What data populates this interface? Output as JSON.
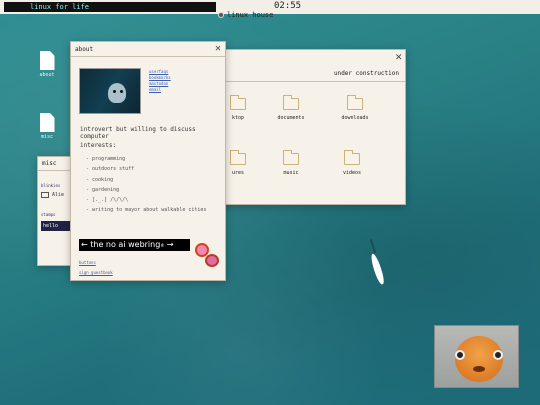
{
  "topbar": {
    "banner_text": "linux for life",
    "clock": "02:55",
    "location_label": "linux house"
  },
  "desktop_icons": [
    {
      "label": "about"
    },
    {
      "label": "misc"
    }
  ],
  "under_construction_window": {
    "title": "under construction",
    "folders": [
      {
        "name": "desktop",
        "shown_text": "ktop"
      },
      {
        "name": "documents",
        "shown_text": "documents"
      },
      {
        "name": "downloads",
        "shown_text": "downloads"
      },
      {
        "name": "pictures",
        "shown_text": "ures"
      },
      {
        "name": "music",
        "shown_text": "music"
      },
      {
        "name": "videos",
        "shown_text": "videos"
      }
    ]
  },
  "misc_window": {
    "title": "misc",
    "section1": "blinkies",
    "item_label": "Alie",
    "section2": "stamps",
    "badge_text": "hello"
  },
  "about_window": {
    "title": "about",
    "links": [
      "userfaqs",
      "bookmarks",
      "mastodon",
      "email"
    ],
    "tagline": "introvert but willing to discuss computer",
    "interests_title": "interests:",
    "interests": [
      "programming",
      "outdoors stuff",
      "cooking",
      "gardening",
      "[._.] /\\/\\/\\",
      "writing to mayor about walkable cities"
    ],
    "webring_prev": "←",
    "webring_text": "the no ai webring",
    "webring_mark": "®",
    "webring_next": "→",
    "footer_links": [
      "buttons",
      "sign guestbook"
    ]
  }
}
